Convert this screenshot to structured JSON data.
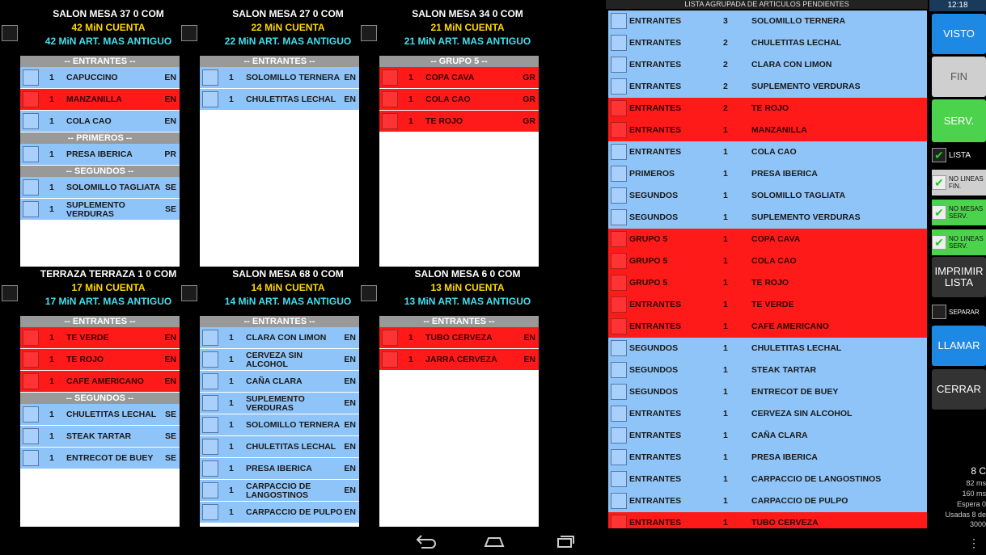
{
  "tickets": [
    {
      "title": "SALON MESA  37  0 COM",
      "cuenta": "42 MiN CUENTA",
      "antiguo": "42 MiN ART. MAS ANTIGUO",
      "sections": [
        {
          "label": "-- ENTRANTES --",
          "items": [
            {
              "q": "1",
              "name": "CAPUCCINO",
              "code": "EN",
              "color": "blue"
            },
            {
              "q": "1",
              "name": "MANZANILLA",
              "code": "EN",
              "color": "red"
            },
            {
              "q": "1",
              "name": "COLA CAO",
              "code": "EN",
              "color": "blue"
            }
          ]
        },
        {
          "label": "-- PRIMEROS --",
          "items": [
            {
              "q": "1",
              "name": "PRESA IBERICA",
              "code": "PR",
              "color": "blue"
            }
          ]
        },
        {
          "label": "-- SEGUNDOS --",
          "items": [
            {
              "q": "1",
              "name": "SOLOMILLO TAGLIATA",
              "code": "SE",
              "color": "blue"
            },
            {
              "q": "1",
              "name": "SUPLEMENTO VERDURAS",
              "code": "SE",
              "color": "blue"
            }
          ]
        }
      ]
    },
    {
      "title": "SALON MESA  27  0 COM",
      "cuenta": "22 MiN CUENTA",
      "antiguo": "22 MiN ART. MAS ANTIGUO",
      "sections": [
        {
          "label": "-- ENTRANTES --",
          "items": [
            {
              "q": "1",
              "name": "SOLOMILLO TERNERA",
              "code": "EN",
              "color": "blue"
            },
            {
              "q": "1",
              "name": "CHULETITAS LECHAL",
              "code": "EN",
              "color": "blue"
            }
          ]
        }
      ]
    },
    {
      "title": "SALON MESA  34  0 COM",
      "cuenta": "21 MiN CUENTA",
      "antiguo": "21 MiN ART. MAS ANTIGUO",
      "sections": [
        {
          "label": "-- GRUPO 5 --",
          "items": [
            {
              "q": "1",
              "name": "COPA CAVA",
              "code": "GR",
              "color": "red"
            },
            {
              "q": "1",
              "name": "COLA CAO",
              "code": "GR",
              "color": "red"
            },
            {
              "q": "1",
              "name": "TE ROJO",
              "code": "GR",
              "color": "red"
            }
          ]
        }
      ]
    },
    {
      "title": "TERRAZA TERRAZA 1  0 COM",
      "cuenta": "17 MiN CUENTA",
      "antiguo": "17 MiN ART. MAS ANTIGUO",
      "sections": [
        {
          "label": "-- ENTRANTES --",
          "items": [
            {
              "q": "1",
              "name": "TE VERDE",
              "code": "EN",
              "color": "red"
            },
            {
              "q": "1",
              "name": "TE ROJO",
              "code": "EN",
              "color": "red"
            },
            {
              "q": "1",
              "name": "CAFE AMERICANO",
              "code": "EN",
              "color": "red"
            }
          ]
        },
        {
          "label": "-- SEGUNDOS --",
          "items": [
            {
              "q": "1",
              "name": "CHULETITAS LECHAL",
              "code": "SE",
              "color": "blue"
            },
            {
              "q": "1",
              "name": "STEAK TARTAR",
              "code": "SE",
              "color": "blue"
            },
            {
              "q": "1",
              "name": "ENTRECOT DE BUEY",
              "code": "SE",
              "color": "blue"
            }
          ]
        }
      ]
    },
    {
      "title": "SALON MESA  68  0 COM",
      "cuenta": "14 MiN CUENTA",
      "antiguo": "14 MiN ART. MAS ANTIGUO",
      "sections": [
        {
          "label": "-- ENTRANTES --",
          "items": [
            {
              "q": "1",
              "name": "CLARA CON LIMON",
              "code": "EN",
              "color": "blue"
            },
            {
              "q": "1",
              "name": "CERVEZA SIN ALCOHOL",
              "code": "EN",
              "color": "blue"
            },
            {
              "q": "1",
              "name": "CAÑA CLARA",
              "code": "EN",
              "color": "blue"
            },
            {
              "q": "1",
              "name": "SUPLEMENTO VERDURAS",
              "code": "EN",
              "color": "blue"
            },
            {
              "q": "1",
              "name": "SOLOMILLO TERNERA",
              "code": "EN",
              "color": "blue"
            },
            {
              "q": "1",
              "name": "CHULETITAS LECHAL",
              "code": "EN",
              "color": "blue"
            },
            {
              "q": "1",
              "name": "PRESA IBERICA",
              "code": "EN",
              "color": "blue"
            },
            {
              "q": "1",
              "name": "CARPACCIO DE LANGOSTINOS",
              "code": "EN",
              "color": "blue"
            },
            {
              "q": "1",
              "name": "CARPACCIO DE PULPO",
              "code": "EN",
              "color": "blue"
            }
          ]
        }
      ]
    },
    {
      "title": "SALON MESA  6  0 COM",
      "cuenta": "13 MiN CUENTA",
      "antiguo": "13 MiN ART. MAS ANTIGUO",
      "sections": [
        {
          "label": "-- ENTRANTES --",
          "items": [
            {
              "q": "1",
              "name": "TUBO CERVEZA",
              "code": "EN",
              "color": "red"
            },
            {
              "q": "1",
              "name": "JARRA CERVEZA",
              "code": "EN",
              "color": "red"
            }
          ]
        }
      ]
    }
  ],
  "grouped": {
    "title": "LISTA AGRUPADA DE ARTICULOS PENDIENTES",
    "rows": [
      {
        "s": "ENTRANTES",
        "q": "3",
        "n": "SOLOMILLO TERNERA",
        "color": "blue"
      },
      {
        "s": "ENTRANTES",
        "q": "2",
        "n": "CHULETITAS LECHAL",
        "color": "blue"
      },
      {
        "s": "ENTRANTES",
        "q": "2",
        "n": "CLARA CON LIMON",
        "color": "blue"
      },
      {
        "s": "ENTRANTES",
        "q": "2",
        "n": "SUPLEMENTO VERDURAS",
        "color": "blue"
      },
      {
        "s": "ENTRANTES",
        "q": "2",
        "n": "TE ROJO",
        "color": "red"
      },
      {
        "s": "ENTRANTES",
        "q": "1",
        "n": "MANZANILLA",
        "color": "red"
      },
      {
        "s": "ENTRANTES",
        "q": "1",
        "n": "COLA CAO",
        "color": "blue"
      },
      {
        "s": "PRIMEROS",
        "q": "1",
        "n": "PRESA IBERICA",
        "color": "blue"
      },
      {
        "s": "SEGUNDOS",
        "q": "1",
        "n": "SOLOMILLO TAGLIATA",
        "color": "blue"
      },
      {
        "s": "SEGUNDOS",
        "q": "1",
        "n": "SUPLEMENTO VERDURAS",
        "color": "blue"
      },
      {
        "s": "GRUPO 5",
        "q": "1",
        "n": "COPA CAVA",
        "color": "red"
      },
      {
        "s": "GRUPO 5",
        "q": "1",
        "n": "COLA CAO",
        "color": "red"
      },
      {
        "s": "GRUPO 5",
        "q": "1",
        "n": "TE ROJO",
        "color": "red"
      },
      {
        "s": "ENTRANTES",
        "q": "1",
        "n": "TE VERDE",
        "color": "red"
      },
      {
        "s": "ENTRANTES",
        "q": "1",
        "n": "CAFE AMERICANO",
        "color": "red"
      },
      {
        "s": "SEGUNDOS",
        "q": "1",
        "n": "CHULETITAS LECHAL",
        "color": "blue"
      },
      {
        "s": "SEGUNDOS",
        "q": "1",
        "n": "STEAK TARTAR",
        "color": "blue"
      },
      {
        "s": "SEGUNDOS",
        "q": "1",
        "n": "ENTRECOT DE BUEY",
        "color": "blue"
      },
      {
        "s": "ENTRANTES",
        "q": "1",
        "n": "CERVEZA SIN ALCOHOL",
        "color": "blue"
      },
      {
        "s": "ENTRANTES",
        "q": "1",
        "n": "CAÑA CLARA",
        "color": "blue"
      },
      {
        "s": "ENTRANTES",
        "q": "1",
        "n": "PRESA IBERICA",
        "color": "blue"
      },
      {
        "s": "ENTRANTES",
        "q": "1",
        "n": "CARPACCIO DE LANGOSTINOS",
        "color": "blue"
      },
      {
        "s": "ENTRANTES",
        "q": "1",
        "n": "CARPACCIO DE PULPO",
        "color": "blue"
      },
      {
        "s": "ENTRANTES",
        "q": "1",
        "n": "TUBO CERVEZA",
        "color": "red"
      }
    ]
  },
  "side": {
    "clock": "12:18",
    "visto": "VISTO",
    "fin": "FIN",
    "serv": "SERV.",
    "lista": "LISTA",
    "no_lineas_fin": "NO LINEAS FIN.",
    "no_mesas_serv": "NO MESAS SERV.",
    "no_lineas_serv": "NO LINEAS SERV.",
    "imprimir": "IMPRIMIR LISTA",
    "separar": "SEPARAR",
    "llamar": "LLAMAR",
    "cerrar": "CERRAR",
    "stat1": "8 C",
    "stat2": "82 ms",
    "stat3": "160 ms",
    "stat4": "Espera 0",
    "stat5": "Usadas 8 de",
    "stat6": "3000",
    "colors": {
      "visto": "#1e88e5",
      "fin": "#cfcfcf",
      "serv": "#4cd24c",
      "llamar": "#1e88e5",
      "cerrar": "#333333",
      "imprimir": "#333333"
    }
  },
  "nav": {
    "back": "back-icon",
    "home": "home-icon",
    "recents": "recents-icon"
  }
}
